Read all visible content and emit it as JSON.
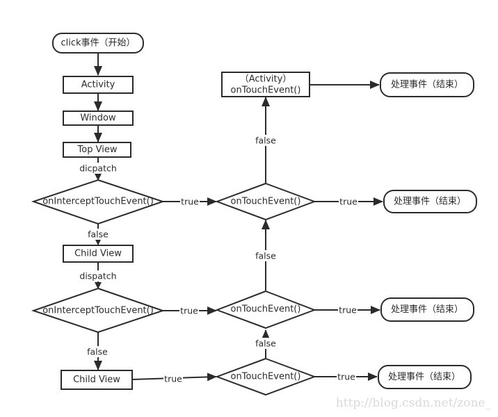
{
  "diagram": {
    "nodes": {
      "start": "click事件（开始）",
      "activity": "Activity",
      "window": "Window",
      "top_view": "Top View",
      "intercept_1": "onInterceptTouchEvent()",
      "child_view_1": "Child View",
      "intercept_2": "onInterceptTouchEvent()",
      "child_view_2": "Child View",
      "touch_1": "onTouchEvent()",
      "touch_2": "onTouchEvent()",
      "touch_3": "onTouchEvent()",
      "activity_touch_line1": "（Activity）",
      "activity_touch_line2": "onTouchEvent()",
      "end_1": "处理事件（结束）",
      "end_2": "处理事件（结束）",
      "end_3": "处理事件（结束）",
      "end_4": "处理事件（结束）"
    },
    "edge_labels": {
      "top_view_dispatch": "dicpatch",
      "intercept_1_true": "true",
      "intercept_1_false": "false",
      "child_view_1_dispatch": "dispatch",
      "intercept_2_true": "true",
      "intercept_2_false": "false",
      "child_view_2_true": "true",
      "touch_3_true": "true",
      "touch_3_false": "false",
      "touch_2_true": "true",
      "touch_2_false": "false",
      "touch_1_true": "true",
      "touch_1_false": "false"
    }
  },
  "watermark": "http://blog.csdn.net/zone_"
}
